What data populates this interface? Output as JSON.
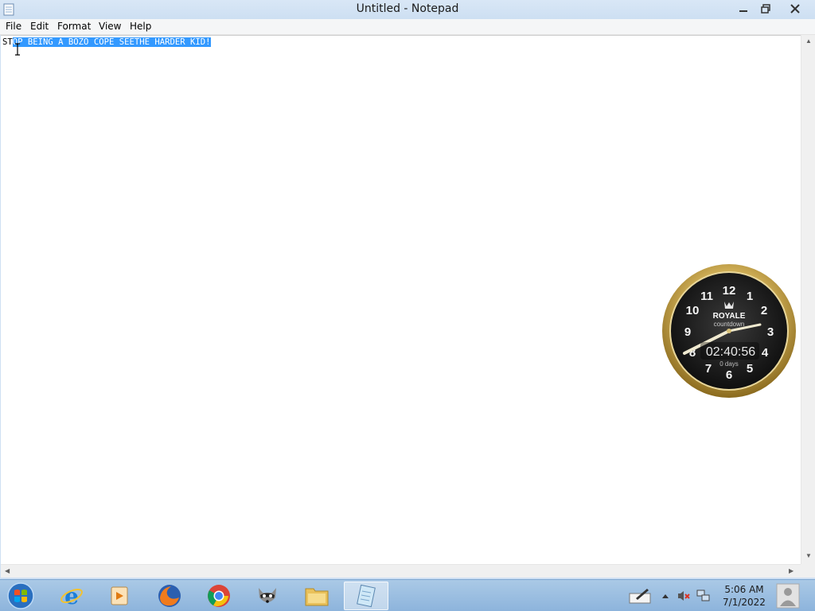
{
  "window": {
    "title": "Untitled - Notepad",
    "minimize_label": "minimize",
    "maximize_label": "restore",
    "close_label": "close"
  },
  "menu": [
    "File",
    "Edit",
    "Format",
    "View",
    "Help"
  ],
  "editor": {
    "text_before_selection": "ST",
    "selected_text": "OP BEING A BOZO COPE SEETHE HARDER KID!"
  },
  "gadget": {
    "brand": "ROYALE",
    "subtitle": "countdown",
    "time": "02:40:56",
    "days": "0 days",
    "numerals": [
      "12",
      "1",
      "2",
      "3",
      "4",
      "5",
      "6",
      "7",
      "8",
      "9",
      "10",
      "11"
    ]
  },
  "taskbar": {
    "apps": [
      {
        "name": "internet-explorer-icon",
        "active": false
      },
      {
        "name": "media-player-icon",
        "active": false
      },
      {
        "name": "firefox-icon",
        "active": false
      },
      {
        "name": "chrome-icon",
        "active": false
      },
      {
        "name": "raccoon-app-icon",
        "active": false
      },
      {
        "name": "file-explorer-icon",
        "active": false
      },
      {
        "name": "notepad-icon",
        "active": true
      }
    ],
    "clock_time": "5:06 AM",
    "clock_date": "7/1/2022"
  },
  "colors": {
    "selection": "#3399ff",
    "close_button": "#c42b1c",
    "taskbar": "#9fc2e3"
  }
}
